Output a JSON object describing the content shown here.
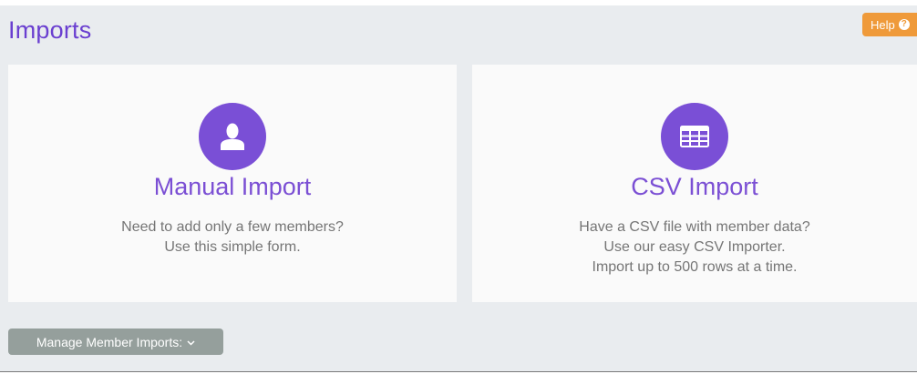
{
  "header": {
    "title": "Imports",
    "help_label": "Help",
    "help_icon": "question-circle-icon"
  },
  "cards": {
    "manual": {
      "icon": "user-icon",
      "title": "Manual Import",
      "desc_line1": "Need to add only a few members?",
      "desc_line2": "Use this simple form."
    },
    "csv": {
      "icon": "table-icon",
      "title": "CSV Import",
      "desc_line1": "Have a CSV file with member data?",
      "desc_line2": "Use our easy CSV Importer.",
      "desc_line3": "Import up to 500 rows at a time."
    }
  },
  "footer": {
    "manage_label": "Manage Member Imports:",
    "manage_icon": "chevron-down-icon"
  },
  "colors": {
    "accent": "#7b4fd4",
    "help_button": "#ef9a3a",
    "manage_button": "#959f9c",
    "background": "#e9ecef",
    "card": "#fafafa"
  }
}
